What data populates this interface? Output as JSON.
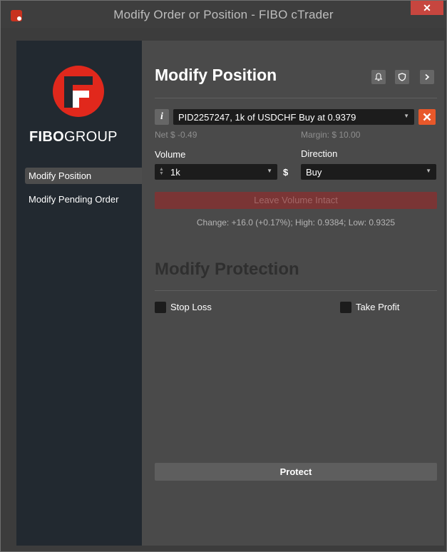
{
  "window": {
    "title": "Modify Order or Position - FIBO cTrader",
    "close_glyph": "✕"
  },
  "sidebar": {
    "brand_bold": "FIBO",
    "brand_rest": "GROUP",
    "items": [
      {
        "label": "Modify Position",
        "active": true
      },
      {
        "label": "Modify Pending Order",
        "active": false
      }
    ]
  },
  "header": {
    "title": "Modify Position",
    "icons": [
      "bell-icon",
      "shield-icon",
      "chevron-right-icon"
    ]
  },
  "position": {
    "info_glyph": "i",
    "selected": "PID2257247, 1k of USDCHF Buy at 0.9379",
    "net": "Net $ -0.49",
    "margin": "Margin: $ 10.00"
  },
  "volume": {
    "label": "Volume",
    "value": "1k",
    "currency": "$"
  },
  "direction": {
    "label": "Direction",
    "value": "Buy"
  },
  "leave_volume_button": "Leave Volume Intact",
  "market": {
    "change_text": "Change: +16.0 (+0.17%); High: 0.9384; Low: 0.9325"
  },
  "protection": {
    "title": "Modify Protection",
    "stop_loss_label": "Stop Loss",
    "take_profit_label": "Take Profit",
    "stop_loss_checked": false,
    "take_profit_checked": false
  },
  "protect_button": "Protect",
  "colors": {
    "accent_orange": "#e8582a",
    "brand_red": "#e1281c",
    "sidebar_bg": "#222930"
  }
}
